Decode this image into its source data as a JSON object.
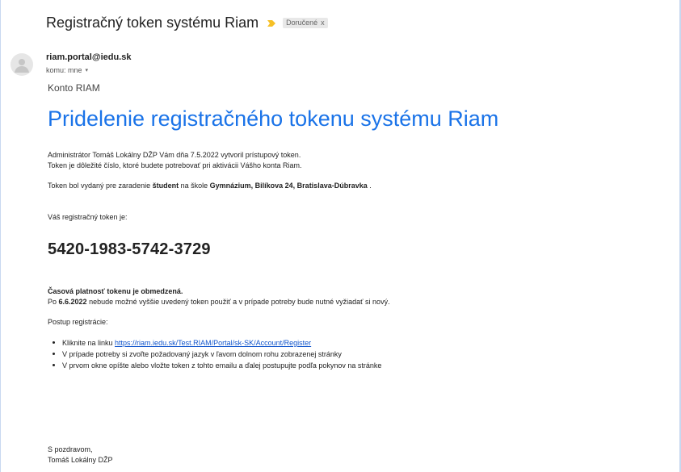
{
  "message": {
    "subject": "Registračný token systému Riam",
    "label": "Doručené",
    "label_close": "x",
    "sender": "riam.portal@iedu.sk",
    "recipient": "komu: mne",
    "recipient_menu_icon": "▾"
  },
  "content": {
    "account": "Konto RIAM",
    "heading": "Pridelenie registračného tokenu systému Riam",
    "intro_line_1": "Administrátor Tomáš Lokálny DŽP Vám dňa 7.5.2022 vytvoril prístupový token.",
    "intro_line_2": "Token je dôležité číslo, ktoré budete potrebovať pri aktivácii Vášho konta Riam.",
    "assignment_prefix": "Token bol vydaný pre zaradenie ",
    "assignment_role": "študent",
    "assignment_mid": " na škole ",
    "assignment_school": "Gymnázium, Bilíkova 24, Bratislava-Dúbravka",
    "assignment_end": ".",
    "token_label": "Váš registračný token je:",
    "token": "5420-1983-5742-3729",
    "validity_title": "Časová platnosť tokenu je obmedzená.",
    "validity_prefix": "Po ",
    "validity_date": "6.6.2022",
    "validity_suffix": " nebude možné vyššie uvedený token použiť a v prípade potreby bude nutné vyžiadať si nový.",
    "steps_title": "Postup registrácie:",
    "step_1_prefix": "Kliknite na linku ",
    "step_1_link": "https://riam.iedu.sk/Test.RIAM/Portal/sk-SK/Account/Register",
    "step_2": "V prípade potreby si zvoľte požadovaný jazyk v ľavom dolnom rohu zobrazenej stránky",
    "step_3": "V prvom okne opíšte alebo vložte token z tohto emailu a ďalej postupujte podľa pokynov na stránke",
    "closing_line_1": "S pozdravom,",
    "closing_line_2": "Tomáš Lokálny DŽP"
  },
  "colors": {
    "heading": "#1a73e8",
    "link": "#1155cc",
    "important_marker": "#f6c026",
    "label_chip": "#e8e8e8"
  },
  "icons": {
    "important": "important-marker-icon",
    "label_close": "close-icon",
    "avatar": "person-avatar-icon",
    "recipient_menu": "chevron-down-icon"
  }
}
